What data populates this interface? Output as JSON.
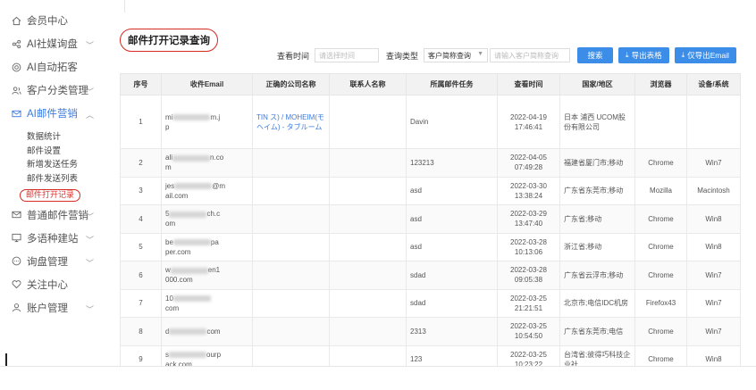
{
  "sidebar": {
    "items": [
      {
        "label": "会员中心",
        "icon": "home-icon",
        "chevron": false
      },
      {
        "label": "AI社媒询盘",
        "icon": "share-icon",
        "chevron": true
      },
      {
        "label": "AI自动拓客",
        "icon": "target-icon",
        "chevron": false
      },
      {
        "label": "客户分类管理",
        "icon": "users-icon",
        "chevron": true
      },
      {
        "label": "AI邮件营销",
        "icon": "mail-icon",
        "chevron": true,
        "active": true
      }
    ],
    "submenu": [
      "数据统计",
      "邮件设置",
      "新增发送任务",
      "邮件发送列表",
      "邮件打开记录"
    ],
    "items_after": [
      {
        "label": "普通邮件营销",
        "icon": "envelope-icon",
        "chevron": true
      },
      {
        "label": "多语种建站",
        "icon": "monitor-icon",
        "chevron": true
      },
      {
        "label": "询盘管理",
        "icon": "chat-icon",
        "chevron": true
      },
      {
        "label": "关注中心",
        "icon": "heart-icon",
        "chevron": false
      },
      {
        "label": "账户管理",
        "icon": "user-icon",
        "chevron": true
      }
    ]
  },
  "page": {
    "title": "邮件打开记录查询"
  },
  "filters": {
    "time_label": "查看时间",
    "time_placeholder": "请选择时间",
    "type_label": "查询类型",
    "type_value": "客户简称查询",
    "keyword_placeholder": "请输入客户简称查询",
    "search_btn": "搜索",
    "export_btn": "导出表格",
    "export_email_btn": "仅导出Email"
  },
  "table": {
    "headers": [
      "序号",
      "收件Email",
      "正确的公司名称",
      "联系人名称",
      "所属邮件任务",
      "查看时间",
      "国家/地区",
      "浏览器",
      "设备/系统"
    ],
    "rows": [
      {
        "no": "1",
        "email_a": "mi",
        "email_b": "m.j",
        "email_c": "p",
        "company": "TIN                  ス) / MOHEIM(モヘイム) - タブルーム",
        "contact": "",
        "task": "Davin",
        "date": "2022-04-19",
        "time": "17:46:41",
        "region": "日本 浦西 UCOM股份有限公司",
        "browser": "",
        "device": ""
      },
      {
        "no": "2",
        "email_a": "ali",
        "email_b": "n.co",
        "email_c": "m",
        "company": "",
        "contact": "",
        "task": "123213",
        "date": "2022-04-05",
        "time": "07:49:28",
        "region": "福建省厦门市;移动",
        "browser": "Chrome",
        "device": "Win7"
      },
      {
        "no": "3",
        "email_a": "jes",
        "email_b": "@m",
        "email_c": "ail.com",
        "company": "",
        "contact": "",
        "task": "asd",
        "date": "2022-03-30",
        "time": "13:38:24",
        "region": "广东省东莞市;移动",
        "browser": "Mozilla",
        "device": "Macintosh"
      },
      {
        "no": "4",
        "email_a": "5",
        "email_b": "ch.c",
        "email_c": "om",
        "company": "",
        "contact": "",
        "task": "asd",
        "date": "2022-03-29",
        "time": "13:47:40",
        "region": "广东省;移动",
        "browser": "Chrome",
        "device": "Win8"
      },
      {
        "no": "5",
        "email_a": "be",
        "email_b": "pa",
        "email_c": "per.com",
        "company": "",
        "contact": "",
        "task": "asd",
        "date": "2022-03-28",
        "time": "10:13:06",
        "region": "浙江省;移动",
        "browser": "Chrome",
        "device": "Win8"
      },
      {
        "no": "6",
        "email_a": "w",
        "email_b": "en1",
        "email_c": "000.com",
        "company": "",
        "contact": "",
        "task": "sdad",
        "date": "2022-03-28",
        "time": "09:05:38",
        "region": "广东省云浮市;移动",
        "browser": "Chrome",
        "device": "Win7"
      },
      {
        "no": "7",
        "email_a": "10",
        "email_b": "",
        "email_c": "com",
        "company": "",
        "contact": "",
        "task": "sdad",
        "date": "2022-03-25",
        "time": "21:21:51",
        "region": "北京市;电信IDC机房",
        "browser": "Firefox43",
        "device": "Win7"
      },
      {
        "no": "8",
        "email_a": "d",
        "email_b": "com",
        "email_c": "",
        "company": "",
        "contact": "",
        "task": "2313",
        "date": "2022-03-25",
        "time": "10:54:50",
        "region": "广东省东莞市;电信",
        "browser": "Chrome",
        "device": "Win7"
      },
      {
        "no": "9",
        "email_a": "s",
        "email_b": "ourp",
        "email_c": "ack.com",
        "company": "",
        "contact": "",
        "task": "123",
        "date": "2022-03-25",
        "time": "10:23:22",
        "region": "台湾省;彼得巧科技企业社",
        "browser": "Chrome",
        "device": "Win8"
      }
    ]
  },
  "colors": {
    "accent": "#3b8de8",
    "highlight": "#d42b22"
  }
}
